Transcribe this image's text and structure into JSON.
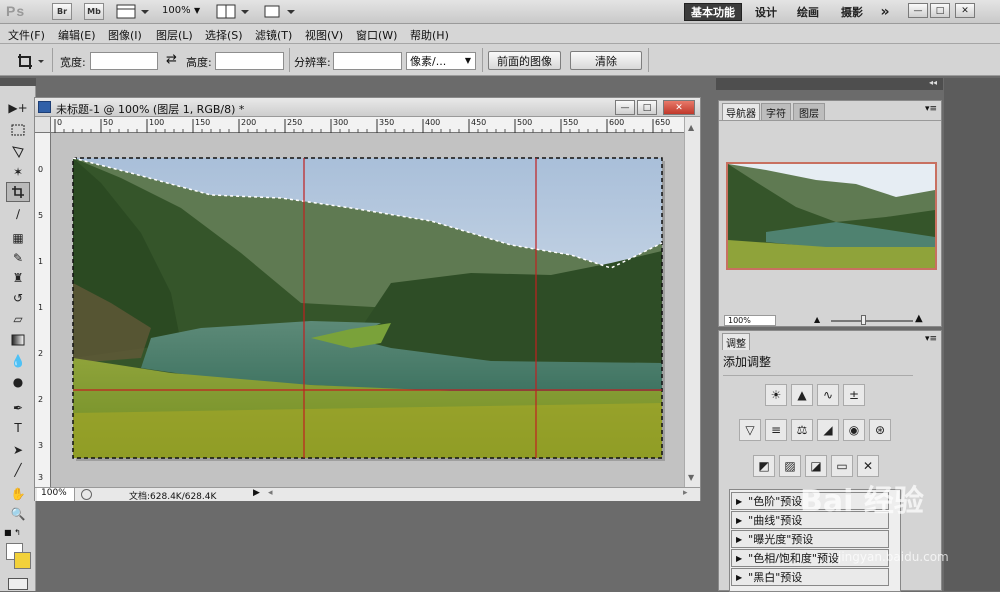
{
  "app": {
    "logo": "Ps",
    "bridge_btn": "Br",
    "minibridge_btn": "Mb",
    "zoom": "100%",
    "workspaces": [
      "基本功能",
      "设计",
      "绘画",
      "摄影"
    ],
    "more": "»"
  },
  "window_controls": {
    "minimize": "—",
    "restore": "□",
    "close": "✕"
  },
  "menu": [
    "文件(F)",
    "编辑(E)",
    "图像(I)",
    "图层(L)",
    "选择(S)",
    "滤镜(T)",
    "视图(V)",
    "窗口(W)",
    "帮助(H)"
  ],
  "options": {
    "width_label": "宽度:",
    "width_value": "",
    "swap_icon": "⇄",
    "height_label": "高度:",
    "height_value": "",
    "resolution_label": "分辨率:",
    "resolution_value": "",
    "unit_select": "像素/...",
    "front_image_btn": "前面的图像",
    "clear_btn": "清除"
  },
  "document": {
    "title": "未标题-1 @ 100% (图层 1, RGB/8) *",
    "ruler_top": [
      "0",
      "50",
      "100",
      "150",
      "200",
      "250",
      "300",
      "350",
      "400",
      "450",
      "500",
      "550",
      "600",
      "650"
    ],
    "ruler_left": [
      "0",
      "5",
      "1",
      "1",
      "2",
      "2",
      "3",
      "3"
    ],
    "zoom": "100%",
    "doc_size": "文档:628.4K/628.4K"
  },
  "navigator": {
    "tabs": [
      "导航器",
      "字符",
      "图层"
    ],
    "zoom": "100%"
  },
  "adjustments": {
    "tab": "调整",
    "heading": "添加调整",
    "presets": [
      "\"色阶\"预设",
      "\"曲线\"预设",
      "\"曝光度\"预设",
      "\"色相/饱和度\"预设",
      "\"黑白\"预设"
    ]
  },
  "watermark": {
    "text": "Bai 经验",
    "sub": "jingyan.baidu.com"
  }
}
